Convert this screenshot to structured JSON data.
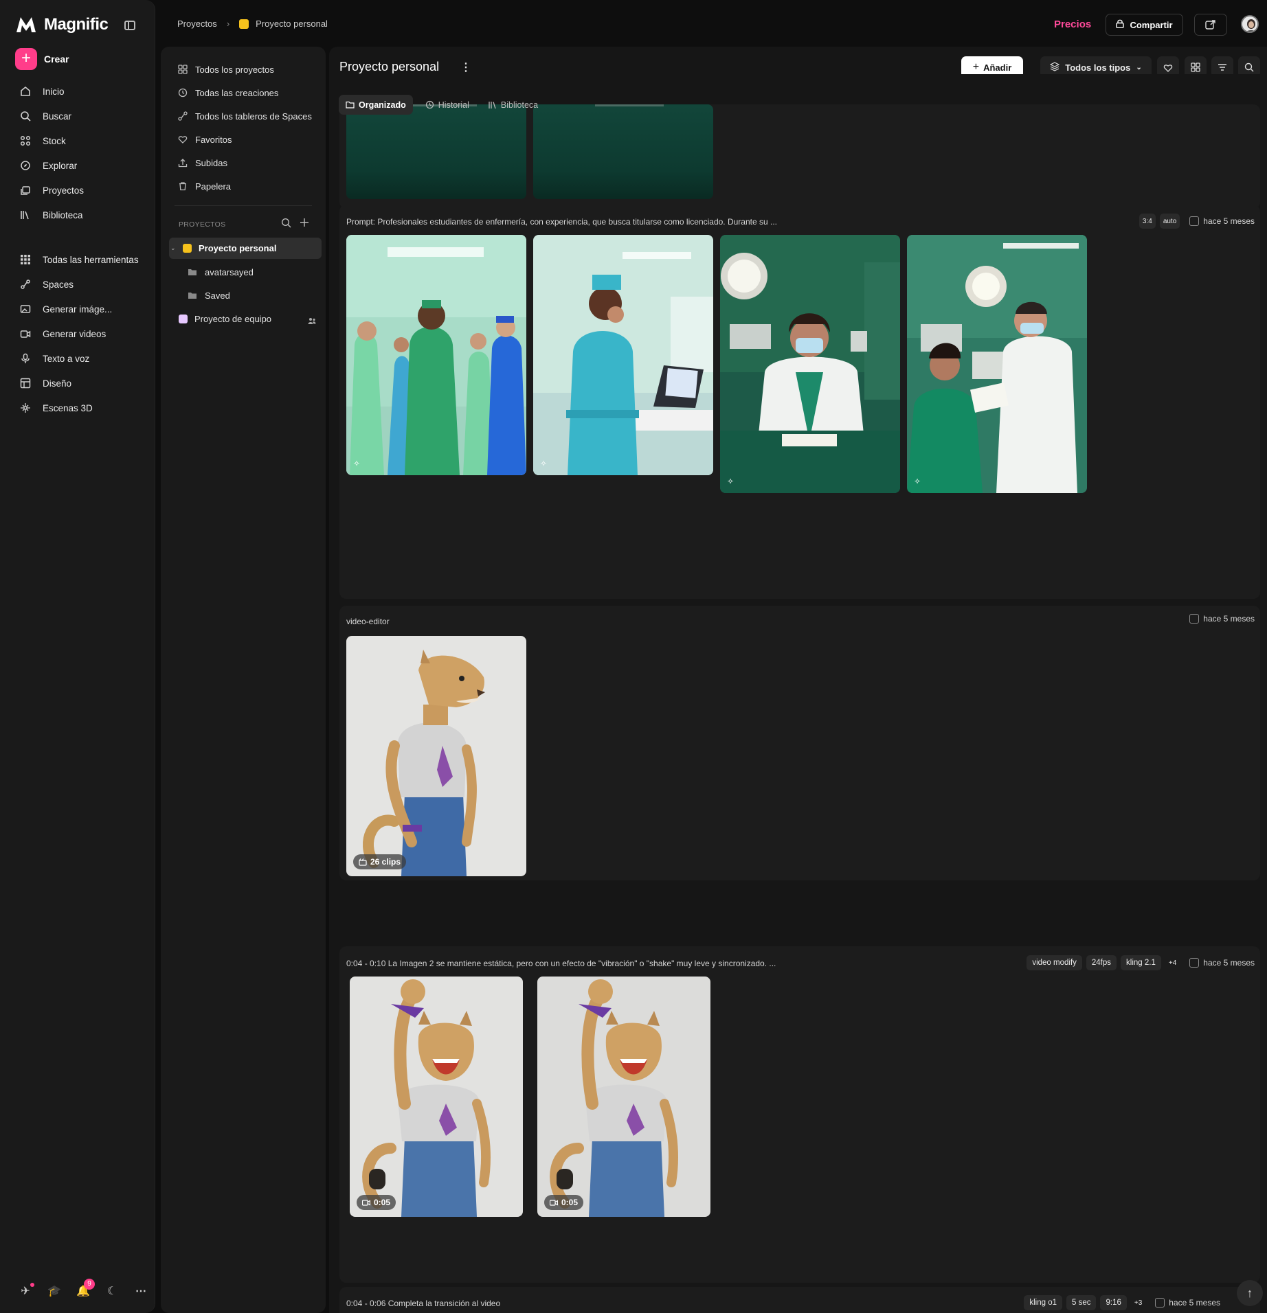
{
  "brand": {
    "name": "Magnific"
  },
  "sidebar": {
    "create_label": "Crear",
    "nav": [
      {
        "label": "Inicio",
        "icon": "home-icon"
      },
      {
        "label": "Buscar",
        "icon": "search-icon"
      },
      {
        "label": "Stock",
        "icon": "grid-icon"
      },
      {
        "label": "Explorar",
        "icon": "compass-icon"
      },
      {
        "label": "Proyectos",
        "icon": "folder-stack-icon"
      },
      {
        "label": "Biblioteca",
        "icon": "library-icon"
      }
    ],
    "tools": [
      {
        "label": "Todas las herramientas",
        "icon": "apps-icon"
      },
      {
        "label": "Spaces",
        "icon": "spaces-icon"
      },
      {
        "label": "Generar imáge...",
        "icon": "image-gen-icon"
      },
      {
        "label": "Generar videos",
        "icon": "video-gen-icon"
      },
      {
        "label": "Texto a voz",
        "icon": "microphone-icon"
      },
      {
        "label": "Diseño",
        "icon": "design-icon"
      },
      {
        "label": "Escenas 3D",
        "icon": "cube-icon"
      }
    ],
    "notifications_count": "9"
  },
  "breadcrumb": {
    "root": "Proyectos",
    "current": "Proyecto personal"
  },
  "topbar": {
    "pricing": "Precios",
    "share": "Compartir"
  },
  "project_panel": {
    "items": [
      {
        "label": "Todos los proyectos",
        "icon": "grid-icon"
      },
      {
        "label": "Todas las creaciones",
        "icon": "history-icon"
      },
      {
        "label": "Todos los tableros de Spaces",
        "icon": "spaces-icon"
      },
      {
        "label": "Favoritos",
        "icon": "heart-icon"
      },
      {
        "label": "Subidas",
        "icon": "upload-icon"
      },
      {
        "label": "Papelera",
        "icon": "trash-icon"
      }
    ],
    "section_label": "PROYECTOS",
    "projects": [
      {
        "label": "Proyecto personal",
        "color": "#f6c21c"
      },
      {
        "label": "avatarsayed"
      },
      {
        "label": "Saved"
      },
      {
        "label": "Proyecto de equipo",
        "color": "#e6c8ff"
      }
    ]
  },
  "main": {
    "title": "Proyecto personal",
    "add_label": "Añadir",
    "types_label": "Todos los tipos",
    "tabs": [
      "Organizado",
      "Historial",
      "Biblioteca"
    ],
    "groups": [
      {
        "prompt": "Prompt: Profesionales estudiantes de enfermería, con experiencia, que busca titularse como licenciado. Durante su ...",
        "tags": [
          "3:4",
          "auto"
        ],
        "time": "hace 5 meses"
      },
      {
        "prompt": "video-editor",
        "tags": [],
        "time": "hace 5 meses",
        "clip_badge": "26 clips"
      },
      {
        "prompt": "0:04 - 0:10 La Imagen 2 se mantiene estática, pero con un efecto de \"vibración\" o \"shake\" muy leve y sincronizado. ...",
        "tags": [
          "video modify",
          "24fps",
          "kling 2.1",
          "+4"
        ],
        "time": "hace 5 meses",
        "durations": [
          "0:05",
          "0:05"
        ]
      },
      {
        "prompt": "0:04 - 0:06 Completa la transición al video",
        "tags": [
          "kling o1",
          "5 sec",
          "9:16",
          "+3"
        ],
        "time": "hace 5 meses"
      }
    ]
  },
  "colors": {
    "accent": "#ff3d8a",
    "pricing": "#ff4a9a",
    "project_yellow": "#f6c21c"
  }
}
